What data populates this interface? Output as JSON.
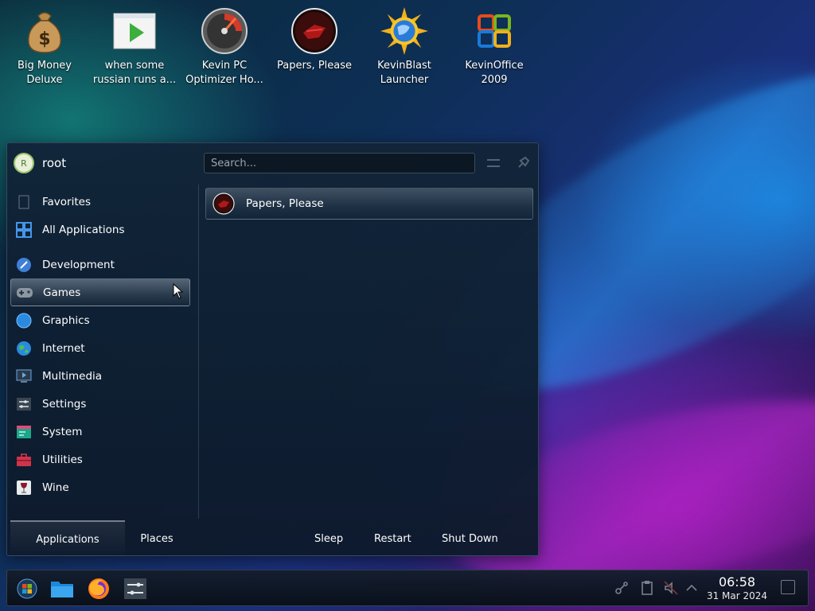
{
  "desktop": {
    "icons": [
      {
        "name": "Big Money\nDeluxe",
        "icon": "money-bag-icon"
      },
      {
        "name": "when some\nrussian runs a...",
        "icon": "video-file-icon"
      },
      {
        "name": "Kevin PC\nOptimizer Ho...",
        "icon": "speedometer-icon"
      },
      {
        "name": "Papers, Please",
        "icon": "papers-please-icon"
      },
      {
        "name": "KevinBlast\nLauncher",
        "icon": "sunburst-globe-icon"
      },
      {
        "name": "KevinOffice\n2009",
        "icon": "office-logo-icon"
      }
    ]
  },
  "launcher": {
    "user": {
      "name": "root",
      "avatar_letter": "R"
    },
    "search": {
      "placeholder": "Search..."
    },
    "categories": [
      {
        "label": "Favorites",
        "icon": "bookmark-icon"
      },
      {
        "label": "All Applications",
        "icon": "grid-icon"
      },
      {
        "label": "Development",
        "icon": "development-icon"
      },
      {
        "label": "Games",
        "icon": "gamepad-icon",
        "active": true
      },
      {
        "label": "Graphics",
        "icon": "graphics-icon"
      },
      {
        "label": "Internet",
        "icon": "globe-icon"
      },
      {
        "label": "Multimedia",
        "icon": "multimedia-icon"
      },
      {
        "label": "Settings",
        "icon": "settings-icon"
      },
      {
        "label": "System",
        "icon": "system-icon"
      },
      {
        "label": "Utilities",
        "icon": "toolbox-icon"
      },
      {
        "label": "Wine",
        "icon": "wine-icon"
      }
    ],
    "results": [
      {
        "label": "Papers, Please",
        "icon": "papers-please-icon"
      }
    ],
    "footer": {
      "tabs": [
        "Applications",
        "Places"
      ],
      "power": [
        "Sleep",
        "Restart",
        "Shut Down"
      ]
    }
  },
  "taskbar": {
    "apps": [
      "start-menu-icon",
      "file-manager-icon",
      "firefox-icon",
      "settings-sliders-icon"
    ],
    "clock": {
      "time": "06:58",
      "date": "31 Mar 2024"
    }
  },
  "colors": {
    "accent_green": "#9cc26a",
    "panel_bg": "#12243a"
  }
}
